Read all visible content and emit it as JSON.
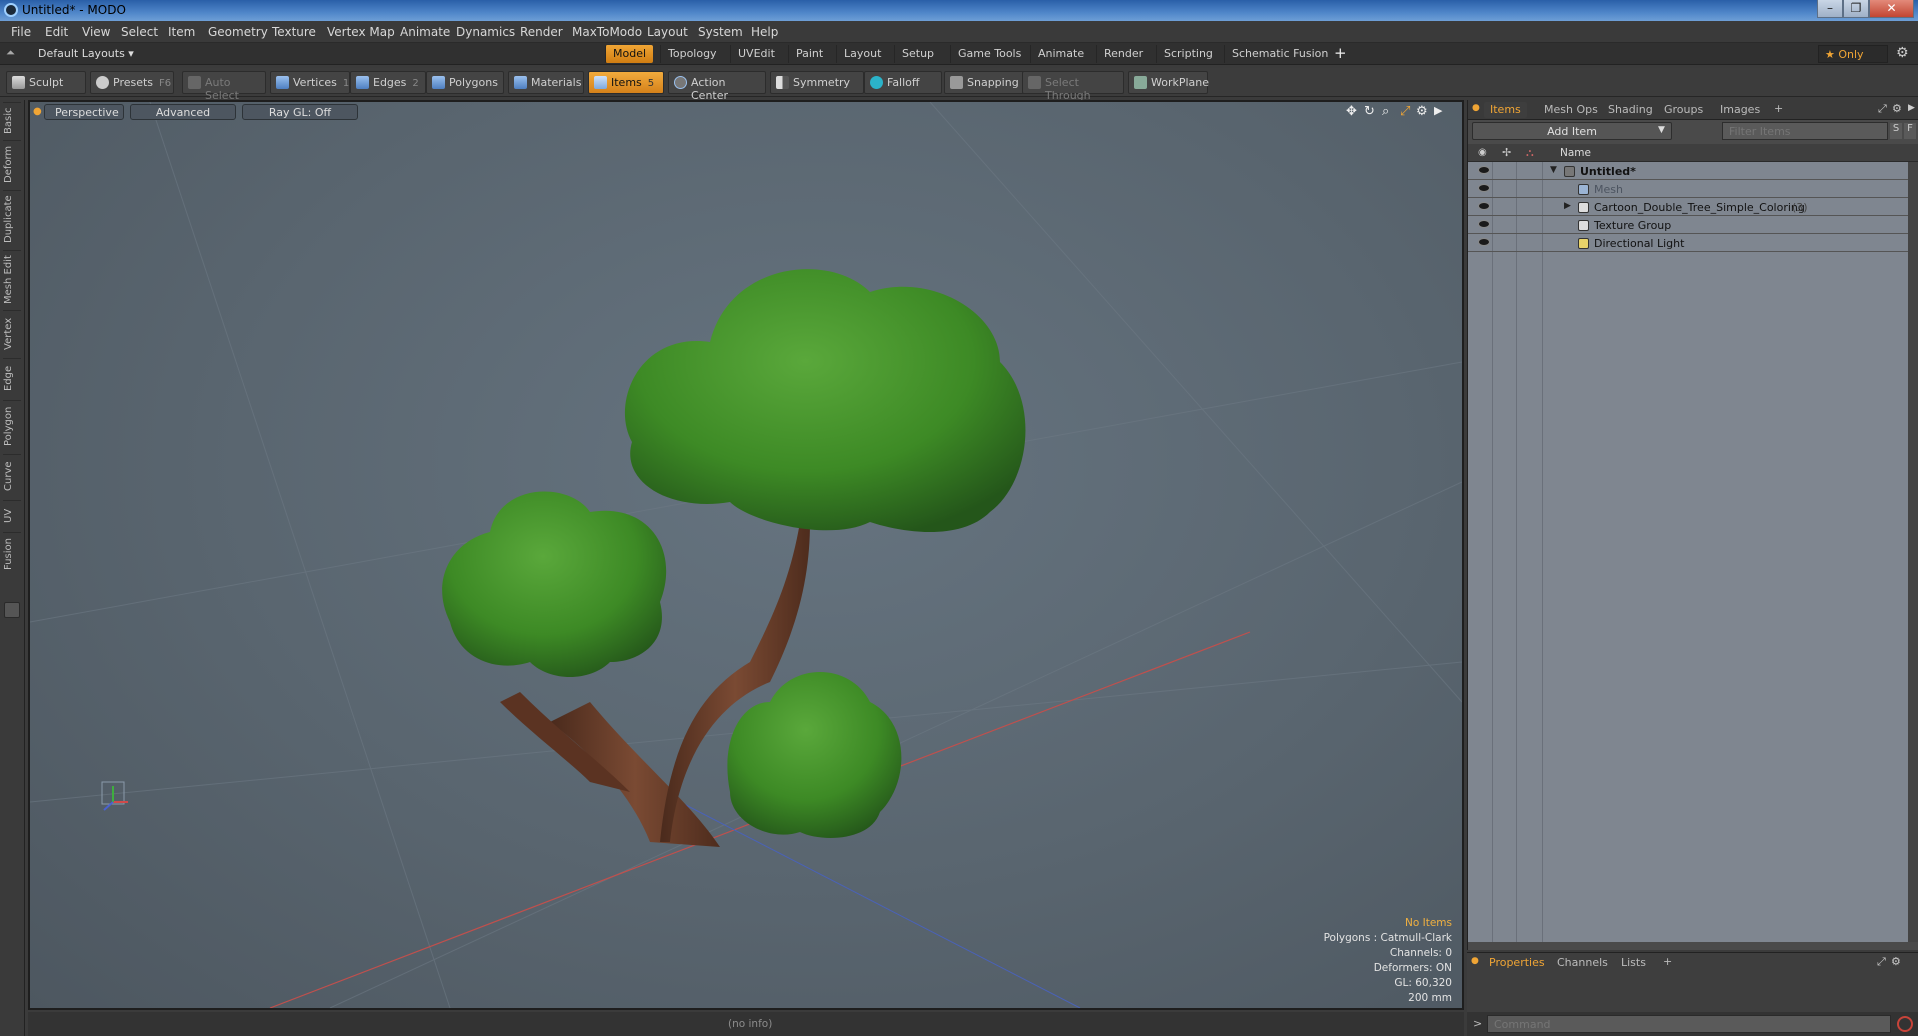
{
  "window": {
    "title": "Untitled* - MODO",
    "buttons": [
      "–",
      "❐",
      "✕"
    ]
  },
  "menu": [
    "File",
    "Edit",
    "View",
    "Select",
    "Item",
    "Geometry",
    "Texture",
    "Vertex Map",
    "Animate",
    "Dynamics",
    "Render",
    "MaxToModo",
    "Layout",
    "System",
    "Help"
  ],
  "layouts": {
    "selector": "Default Layouts ▾",
    "tabs": [
      "Model",
      "Topology",
      "UVEdit",
      "Paint",
      "Layout",
      "Setup",
      "Game Tools",
      "Animate",
      "Render",
      "Scripting",
      "Schematic Fusion"
    ],
    "active": "Model",
    "add": "+",
    "only": "★ Only",
    "gear": "⚙"
  },
  "toolbar": {
    "sculpt": "Sculpt",
    "presets": "Presets",
    "presets_key": "F6",
    "auto_select": "Auto Select",
    "vertices": "Vertices",
    "vertices_key": "1",
    "edges": "Edges",
    "edges_key": "2",
    "polygons": "Polygons",
    "materials": "Materials",
    "items": "Items",
    "items_key": "5",
    "action_center": "Action Center",
    "symmetry": "Symmetry",
    "falloff": "Falloff",
    "snapping": "Snapping",
    "select_through": "Select Through",
    "workplane": "WorkPlane"
  },
  "left_tabs": [
    "Basic",
    "Deform",
    "Duplicate",
    "Mesh Edit",
    "Vertex",
    "Edge",
    "Polygon",
    "Curve",
    "UV",
    "Fusion"
  ],
  "viewport": {
    "view": "Perspective",
    "mode": "Advanced",
    "raygl": "Ray GL: Off",
    "stats": {
      "selection": "No Items",
      "polygons": "Polygons : Catmull-Clark",
      "channels": "Channels: 0",
      "deformers": "Deformers: ON",
      "gl": "GL: 60,320",
      "scale": "200 mm"
    },
    "colors": {
      "foliage": "#3f8a28",
      "trunk": "#6b3f2a"
    }
  },
  "status": {
    "info": "(no info)"
  },
  "items_panel": {
    "tabs": [
      "Items",
      "Mesh Ops",
      "Shading",
      "Groups",
      "Images"
    ],
    "active": "Items",
    "add_item": "Add Item",
    "filter_placeholder": "Filter Items",
    "filter_s": "S",
    "filter_f": "F",
    "column_name": "Name",
    "tree": [
      {
        "label": "Untitled*",
        "bold": true
      },
      {
        "label": "Mesh",
        "dim": true
      },
      {
        "label": "Cartoon_Double_Tree_Simple_Coloring",
        "count": "(3)"
      },
      {
        "label": "Texture Group"
      },
      {
        "label": "Directional Light"
      }
    ]
  },
  "props_panel": {
    "tabs": [
      "Properties",
      "Channels",
      "Lists"
    ],
    "active": "Properties"
  },
  "command": {
    "prompt": ">",
    "placeholder": "Command"
  }
}
